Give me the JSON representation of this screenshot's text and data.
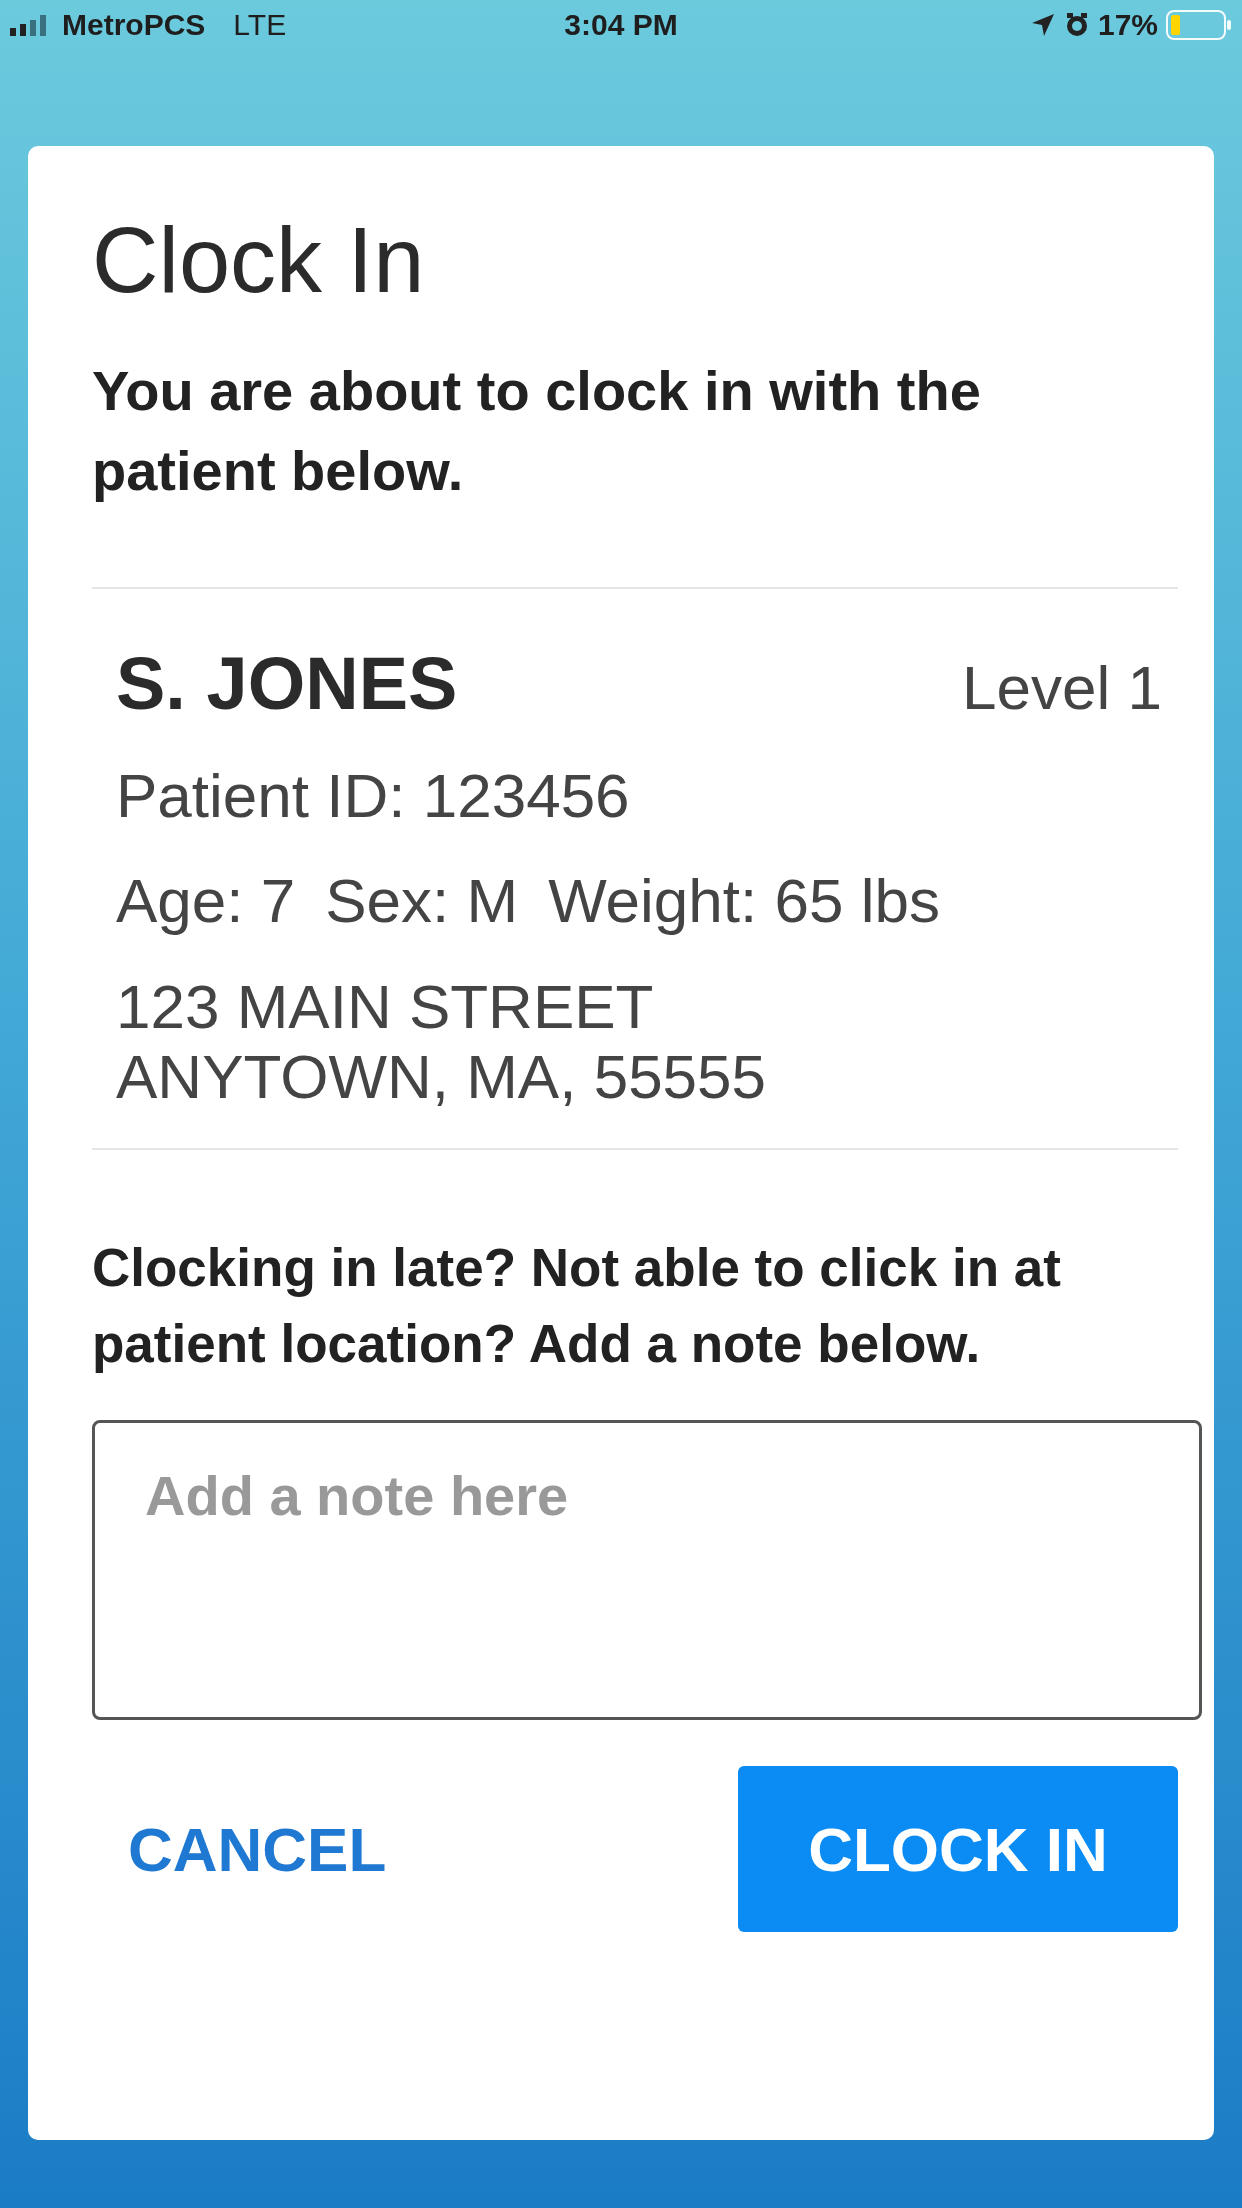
{
  "status_bar": {
    "carrier": "MetroPCS",
    "network": "LTE",
    "time": "3:04 PM",
    "battery": "17%"
  },
  "dialog": {
    "title": "Clock In",
    "intro": "You are about to clock in with the patient below.",
    "patient": {
      "name": "S. JONES",
      "level": "Level 1",
      "patient_id": "Patient ID: 123456",
      "age": "Age: 7",
      "sex": "Sex: M",
      "weight": "Weight: 65 lbs",
      "address_line_1": "123 MAIN STREET",
      "address_line_2": "ANYTOWN, MA, 55555"
    },
    "note_prompt": "Clocking in late? Not able to click in at patient location? Add a note below.",
    "note": {
      "placeholder": "Add a note here"
    },
    "cancel_button": "CANCEL",
    "clock_in_button": "CLOCK IN"
  }
}
